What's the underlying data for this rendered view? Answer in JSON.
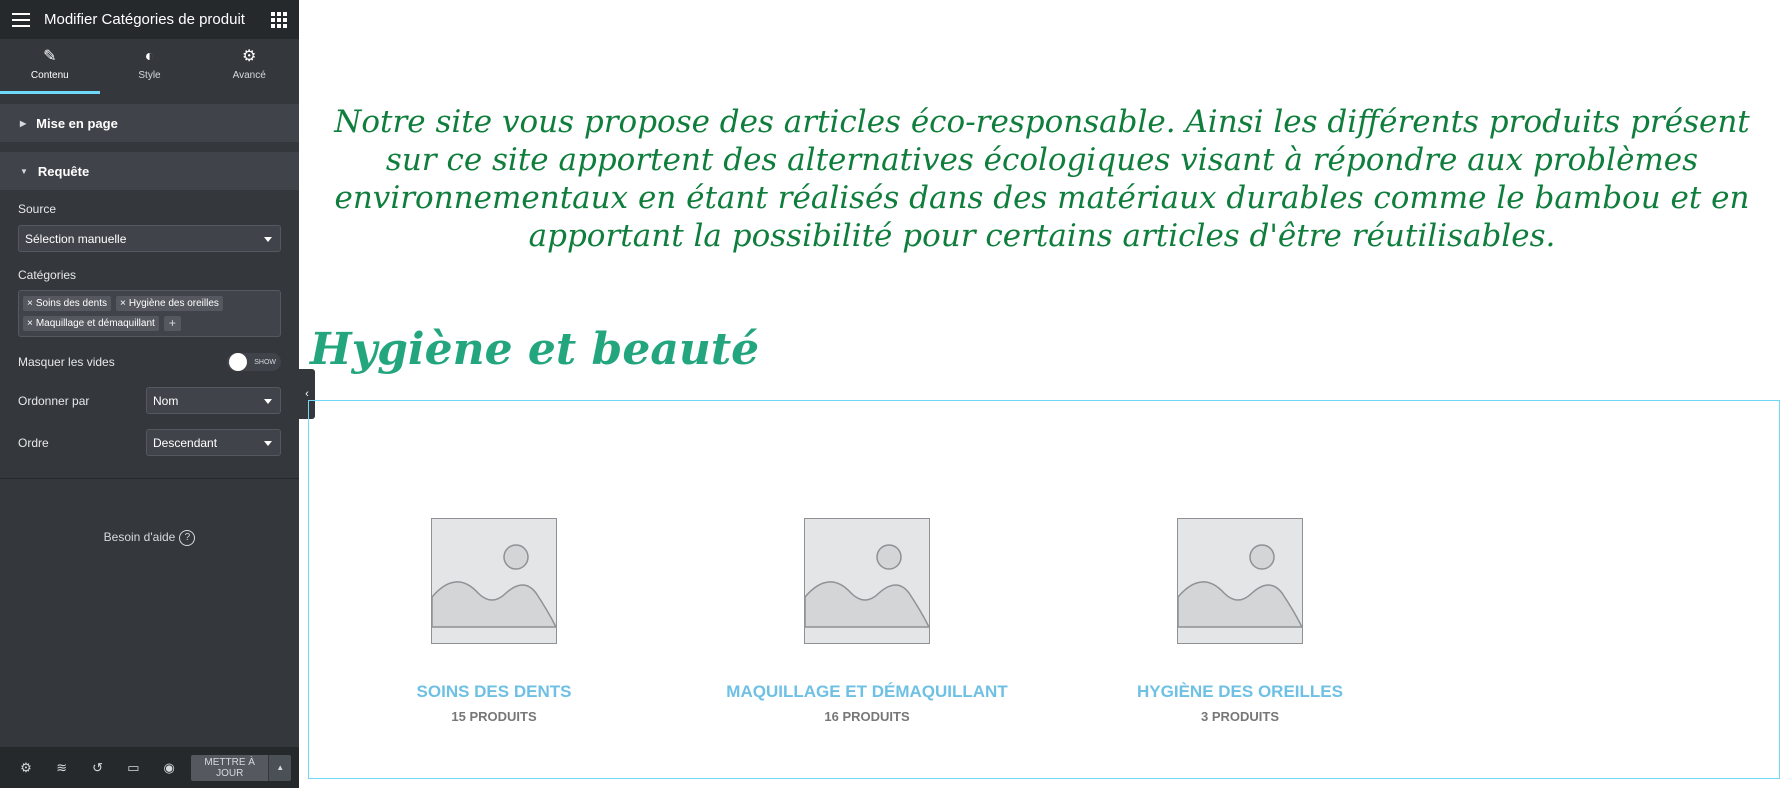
{
  "header": {
    "title": "Modifier Catégories de produit",
    "menu_icon": "hamburger-icon",
    "apps_icon": "apps-grid-icon"
  },
  "tabs": [
    {
      "label": "Contenu",
      "icon": "pencil-icon",
      "active": true
    },
    {
      "label": "Style",
      "icon": "contrast-icon",
      "active": false
    },
    {
      "label": "Avancé",
      "icon": "gear-icon",
      "active": false
    }
  ],
  "sections": {
    "layout": "Mise en page",
    "query": "Requête"
  },
  "query": {
    "source_label": "Source",
    "source_value": "Sélection manuelle",
    "categories_label": "Catégories",
    "categories": [
      "Soins des dents",
      "Hygiène des oreilles",
      "Maquillage et démaquillant"
    ],
    "tag_remove": "×",
    "tag_add": "+",
    "hide_empty_label": "Masquer les vides",
    "hide_empty_toggle": "SHOW",
    "order_by_label": "Ordonner par",
    "order_by_value": "Nom",
    "order_label": "Ordre",
    "order_value": "Descendant"
  },
  "help": {
    "label": "Besoin d'aide",
    "icon": "question-icon",
    "q": "?"
  },
  "footer": {
    "update_label": "METTRE À JOUR",
    "icons": [
      "settings-icon",
      "layers-icon",
      "history-icon",
      "responsive-icon",
      "preview-icon"
    ]
  },
  "canvas": {
    "intro": "Notre site vous propose des articles éco-responsable. Ainsi les différents produits présent sur ce site apportent des alternatives écologiques visant à répondre aux problèmes environnementaux en étant réalisés dans des matériaux durables comme le bambou et en apportant la possibilité pour certains articles d'être réutilisables.",
    "heading": "Hygiène et beauté",
    "categories": [
      {
        "name": "SOINS DES DENTS",
        "count": "15 PRODUITS"
      },
      {
        "name": "MAQUILLAGE ET DÉMAQUILLANT",
        "count": "16 PRODUITS"
      },
      {
        "name": "HYGIÈNE DES OREILLES",
        "count": "3 PRODUITS"
      }
    ]
  },
  "colors": {
    "accent": "#71d7f7",
    "intro_text": "#0f7e3c",
    "heading": "#23a67e",
    "category_name": "#6ec1e4"
  }
}
